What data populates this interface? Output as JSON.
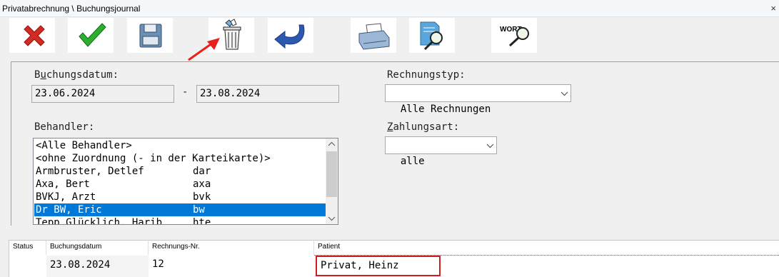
{
  "window": {
    "title": "Privatabrechnung \\ Buchungsjournal",
    "close_symbol": "×"
  },
  "toolbar": {
    "buttons": [
      {
        "name": "cancel-button",
        "icon": "red-x-icon"
      },
      {
        "name": "confirm-button",
        "icon": "green-check-icon"
      },
      {
        "name": "save-button",
        "icon": "floppy-disk-icon"
      },
      {
        "name": "delete-button",
        "icon": "trash-bin-icon"
      },
      {
        "name": "undo-button",
        "icon": "undo-arrow-icon"
      },
      {
        "name": "print-button",
        "icon": "printer-icon"
      },
      {
        "name": "preview-button",
        "icon": "document-magnifier-icon"
      },
      {
        "name": "word-search-button",
        "icon": "word-magnifier-icon",
        "text": "WORT"
      }
    ],
    "annotation_arrow_color": "#e8211c"
  },
  "filters": {
    "buchungsdatum": {
      "label_pre": "B",
      "label_ul": "u",
      "label_post": "chungsdatum:",
      "from": "23.06.2024",
      "separator": "-",
      "to": "23.08.2024"
    },
    "rechnungstyp": {
      "label": "Rechnungstyp:",
      "value": "Alle Rechnungen"
    },
    "behandler": {
      "label": "Behandler:",
      "items": [
        {
          "name": "<Alle Behandler>",
          "code": ""
        },
        {
          "name": "<ohne Zuordnung (- in der Karteikarte)>",
          "code": ""
        },
        {
          "name": "Armbruster, Detlef",
          "code": "dar"
        },
        {
          "name": "Axa, Bert",
          "code": "axa"
        },
        {
          "name": "BVKJ, Arzt",
          "code": "bvk"
        },
        {
          "name": "Dr BW, Eric",
          "code": "bw",
          "selected": true
        },
        {
          "name": "Tepp Glücklich, Harib",
          "code": "hte"
        }
      ],
      "selection_color": "#0078d7"
    },
    "zahlungsart": {
      "label_ul": "Z",
      "label_post": "ahlungsart:",
      "value": "alle"
    }
  },
  "journal": {
    "headers": {
      "status": "Status",
      "buchungsdatum": "Buchungsdatum",
      "rechnungs_nr": "Rechnungs-Nr.",
      "patient": "Patient"
    },
    "rows": [
      {
        "status": "",
        "buchungsdatum": "23.08.2024",
        "rechnungs_nr": "12",
        "patient": "Privat, Heinz"
      }
    ],
    "highlight_color": "#cc1f1f"
  }
}
